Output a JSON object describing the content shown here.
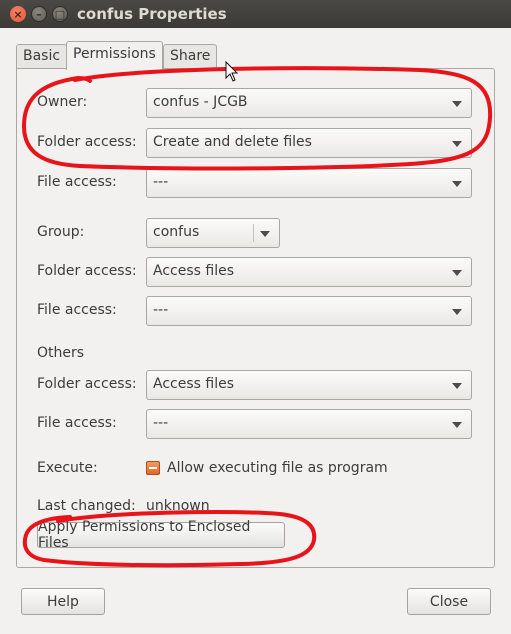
{
  "window": {
    "title": "confus Properties",
    "close_glyph": "×",
    "minimize_glyph": "–",
    "maximize_glyph": "□"
  },
  "tabs": [
    {
      "label": "Basic",
      "active": false
    },
    {
      "label": "Permissions",
      "active": true
    },
    {
      "label": "Share",
      "active": false
    }
  ],
  "owner": {
    "label": "Owner:",
    "value": "confus - JCGB",
    "folder_access_label": "Folder access:",
    "folder_access_value": "Create and delete files",
    "file_access_label": "File access:",
    "file_access_value": "---"
  },
  "group": {
    "label": "Group:",
    "value": "confus",
    "folder_access_label": "Folder access:",
    "folder_access_value": "Access files",
    "file_access_label": "File access:",
    "file_access_value": "---"
  },
  "others": {
    "heading": "Others",
    "folder_access_label": "Folder access:",
    "folder_access_value": "Access files",
    "file_access_label": "File access:",
    "file_access_value": "---"
  },
  "execute": {
    "label": "Execute:",
    "checkbox_label": "Allow executing file as program",
    "state": "mixed"
  },
  "last_changed": {
    "label": "Last changed:",
    "value": "unknown"
  },
  "apply_button_label": "Apply Permissions to Enclosed Files",
  "footer": {
    "help_label": "Help",
    "close_label": "Close"
  },
  "colors": {
    "annotation": "#e8141a",
    "titlebar": "#3c3b37",
    "checkbox_accent": "#e8692a"
  }
}
